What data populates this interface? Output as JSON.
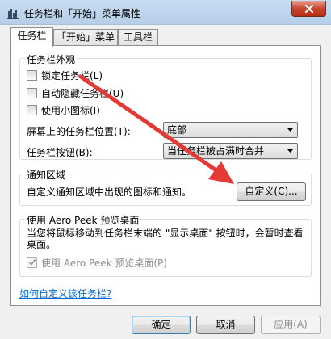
{
  "window": {
    "title": "任务栏和「开始」菜单属性"
  },
  "tabs": [
    {
      "label": "任务栏"
    },
    {
      "label": "「开始」菜单"
    },
    {
      "label": "工具栏"
    }
  ],
  "appearance": {
    "title": "任务栏外观",
    "checkboxes": [
      {
        "label": "锁定任务栏(L)",
        "checked": false
      },
      {
        "label": "自动隐藏任务栏(U)",
        "checked": false
      },
      {
        "label": "使用小图标(I)",
        "checked": false
      }
    ],
    "position_label": "屏幕上的任务栏位置(T):",
    "position_value": "底部",
    "buttons_label": "任务栏按钮(B):",
    "buttons_value": "当任务栏被占满时合并"
  },
  "notification": {
    "title": "通知区域",
    "description": "自定义通知区域中出现的图标和通知。",
    "customize_button": "自定义(C)..."
  },
  "peek": {
    "title": "使用 Aero Peek 预览桌面",
    "description": "当您将鼠标移动到任务栏末端的 \"显示桌面\" 按钮时，会暂时查看桌面。",
    "checkbox_label": "使用 Aero Peek 预览桌面(P)",
    "checkbox_checked": true
  },
  "help_link": "如何自定义该任务栏?",
  "footer": {
    "ok": "确定",
    "cancel": "取消",
    "apply": "应用(A)"
  },
  "colors": {
    "annotation_arrow": "#e53935",
    "link": "#0066cc"
  }
}
